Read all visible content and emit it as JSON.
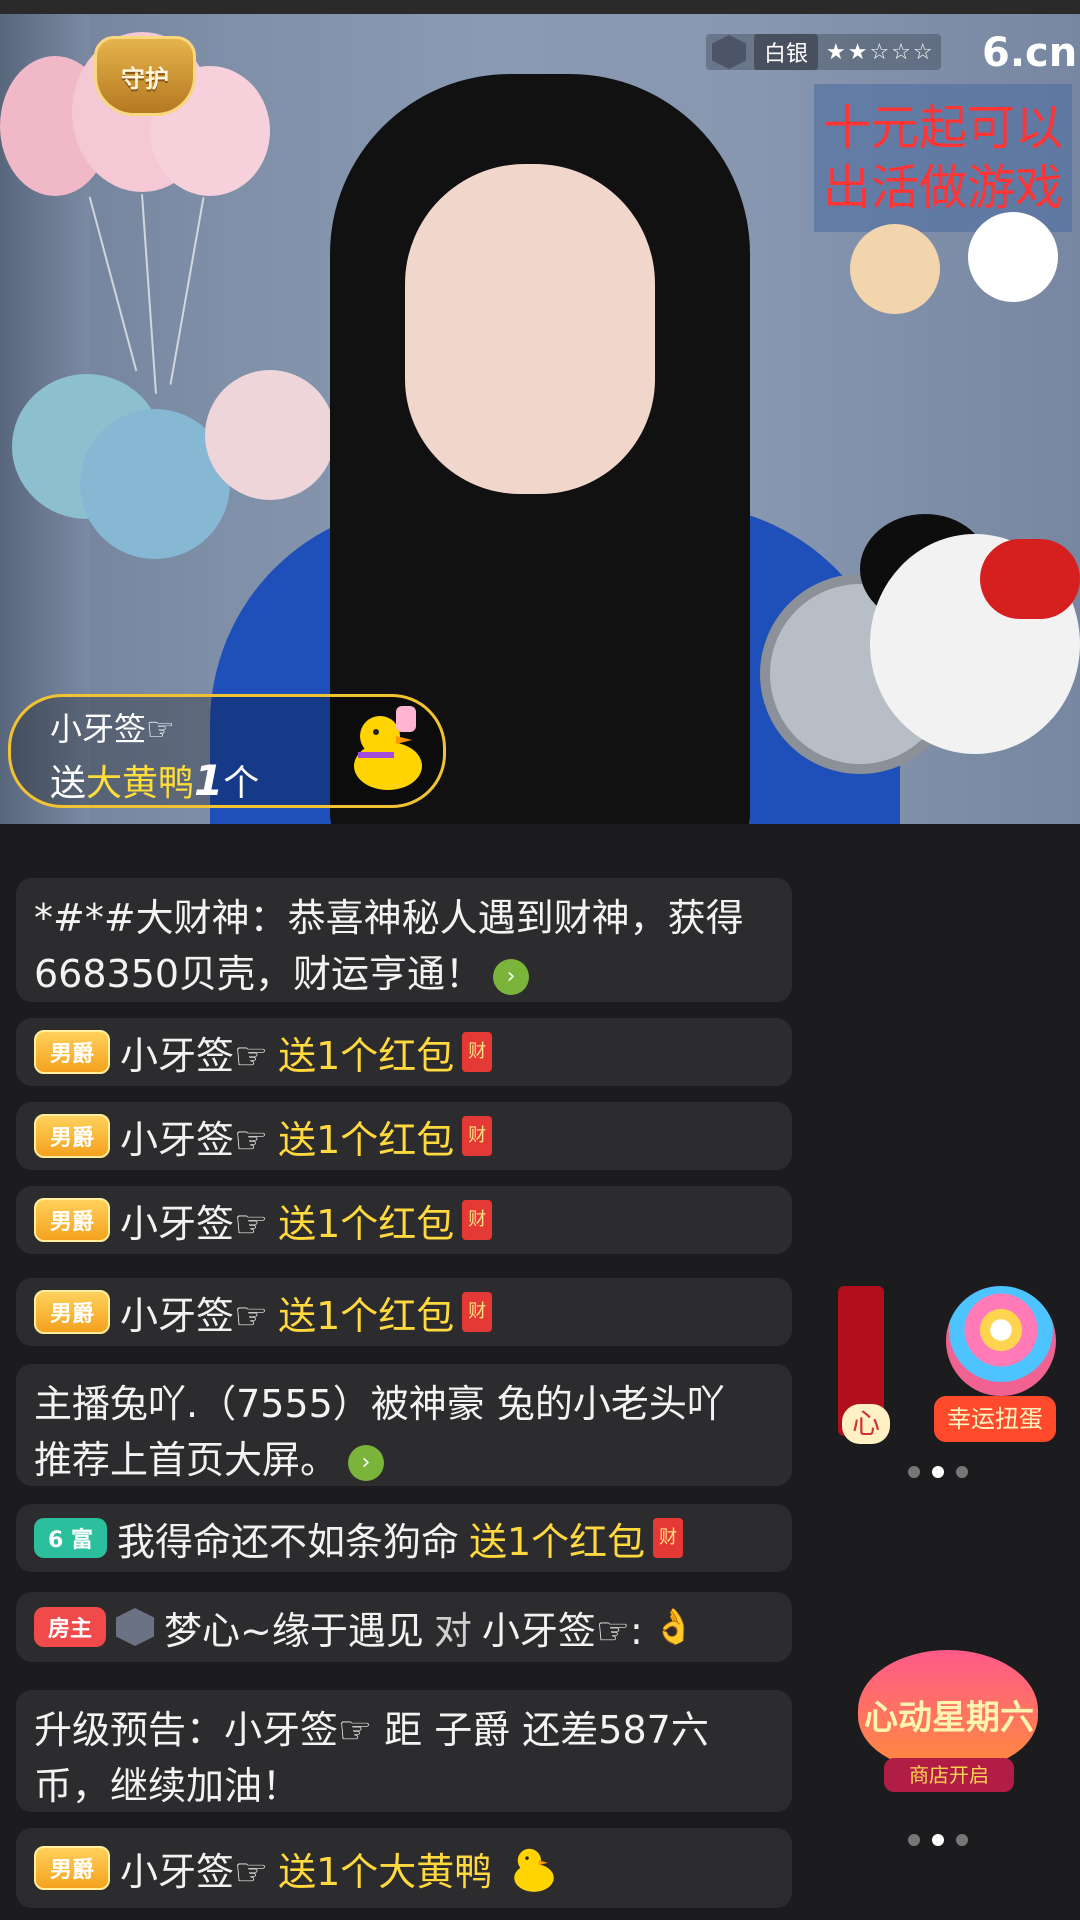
{
  "stream": {
    "guard_badge": "守护",
    "rank_name": "白银",
    "rank_stars": "★★☆☆☆",
    "brand": "6.cn",
    "promo_lines": [
      "十元起可以",
      "出活做游戏"
    ]
  },
  "gift_popup": {
    "user": "小牙签☞",
    "prefix": "送",
    "gift_name": "大黄鸭",
    "count": "1",
    "unit": "个"
  },
  "chat": [
    {
      "type": "system",
      "text": "*#*#大财神：恭喜神秘人遇到财神，获得668350贝壳，财运亨通！"
    },
    {
      "type": "gift",
      "badge": "男爵",
      "user": "小牙签☞",
      "action": "送1个红包",
      "badge_style": "nan"
    },
    {
      "type": "gift",
      "badge": "男爵",
      "user": "小牙签☞",
      "action": "送1个红包",
      "badge_style": "nan"
    },
    {
      "type": "gift",
      "badge": "男爵",
      "user": "小牙签☞",
      "action": "送1个红包",
      "badge_style": "nan"
    },
    {
      "type": "gift",
      "badge": "男爵",
      "user": "小牙签☞",
      "action": "送1个红包",
      "badge_style": "nan"
    },
    {
      "type": "system",
      "text": "主播兔吖.（7555）被神豪 兔的小老头吖 推荐上首页大屏。"
    },
    {
      "type": "gift",
      "badge": "6 富",
      "user": "我得命还不如条狗命",
      "action": "送1个红包",
      "badge_style": "fu"
    },
    {
      "type": "mention",
      "badge": "房主",
      "user": "梦心~缘于遇见",
      "middle": "对",
      "target": "小牙签☞:",
      "badge_style": "fz"
    },
    {
      "type": "system",
      "text": "升级预告：小牙签☞ 距 子爵 还差587六币，继续加油！"
    },
    {
      "type": "gift",
      "badge": "男爵",
      "user": "小牙签☞",
      "action": "送1个大黄鸭",
      "badge_style": "nan"
    }
  ],
  "side": {
    "lucky_label": "幸运扭蛋",
    "heart_label": "心",
    "event_title": "心动星期六",
    "event_subtitle": "商店开启"
  },
  "icons": {
    "arrow": "arrow-right-icon",
    "redpack": "red-envelope-icon",
    "duck": "yellow-duck-icon"
  },
  "colors": {
    "chat_bg": "#2c2c2e",
    "gold": "#ffd93d",
    "accent_green": "#7ab43a",
    "badge_gold": "#f4a11e",
    "badge_green": "#2bbf9d",
    "badge_red": "#f04a4a"
  }
}
